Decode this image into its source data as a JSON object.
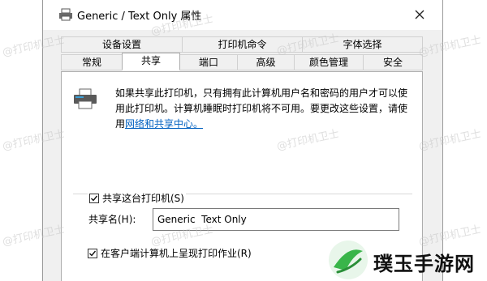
{
  "window": {
    "title": "Generic / Text Only 属性"
  },
  "tabs_row1": [
    "设备设置",
    "打印机命令",
    "字体选择"
  ],
  "tabs_row2": [
    "常规",
    "共享",
    "端口",
    "高级",
    "颜色管理",
    "安全"
  ],
  "active_tab": "共享",
  "info": {
    "text": "如果共享此打印机，只有拥有此计算机用户名和密码的用户才可以使用此打印机。计算机睡眠时打印机将不可用。要更改这些设置，请使用",
    "link": "网络和共享中心。"
  },
  "share": {
    "checkbox_label": "共享这台打印机(S)",
    "checked": true,
    "name_label": "共享名(H):",
    "name_value": "Generic  Text Only"
  },
  "render_jobs": {
    "checkbox_label": "在客户端计算机上呈现打印作业(R)",
    "checked": true
  },
  "watermark_text": "@打印机卫士",
  "brand": {
    "name": "璞玉手游网",
    "accent": "#39b54a"
  },
  "icons": {
    "title": "printer-icon",
    "close": "close-icon",
    "check": "checkmark-icon"
  }
}
